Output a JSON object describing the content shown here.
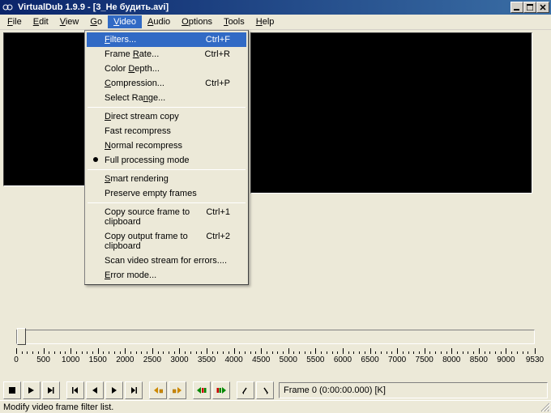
{
  "titlebar": {
    "app_title": "VirtualDub 1.9.9 - [3_Не будить.avi]"
  },
  "menubar": {
    "items": [
      "File",
      "Edit",
      "View",
      "Go",
      "Video",
      "Audio",
      "Options",
      "Tools",
      "Help"
    ],
    "open_index": 4
  },
  "dropdown": {
    "groups": [
      [
        {
          "label": "Filters...",
          "underline_idx": 0,
          "shortcut": "Ctrl+F",
          "highlighted": true
        },
        {
          "label": "Frame Rate...",
          "underline_idx": 6,
          "shortcut": "Ctrl+R"
        },
        {
          "label": "Color Depth...",
          "underline_idx": 6
        },
        {
          "label": "Compression...",
          "underline_idx": 0,
          "shortcut": "Ctrl+P"
        },
        {
          "label": "Select Range...",
          "underline_idx": 9
        }
      ],
      [
        {
          "label": "Direct stream copy",
          "underline_idx": 0
        },
        {
          "label": "Fast recompress"
        },
        {
          "label": "Normal recompress",
          "underline_idx": 0
        },
        {
          "label": "Full processing mode",
          "bullet": true
        }
      ],
      [
        {
          "label": "Smart rendering",
          "underline_idx": 0
        },
        {
          "label": "Preserve empty frames"
        }
      ],
      [
        {
          "label": "Copy source frame to clipboard",
          "shortcut": "Ctrl+1"
        },
        {
          "label": "Copy output frame to clipboard",
          "shortcut": "Ctrl+2"
        },
        {
          "label": "Scan video stream for errors....",
          "underline_idx": null
        },
        {
          "label": "Error mode...",
          "underline_idx": 0
        }
      ]
    ]
  },
  "timeline": {
    "ticks": [
      0,
      500,
      1000,
      1500,
      2000,
      2500,
      3000,
      3500,
      4000,
      4500,
      5000,
      5500,
      6000,
      6500,
      7000,
      7500,
      8000,
      8500,
      9000,
      9530
    ],
    "max": 9530
  },
  "toolbar": {
    "frame_display": "Frame 0 (0:00:00.000) [K]"
  },
  "statusbar": {
    "text": "Modify video frame filter list."
  }
}
